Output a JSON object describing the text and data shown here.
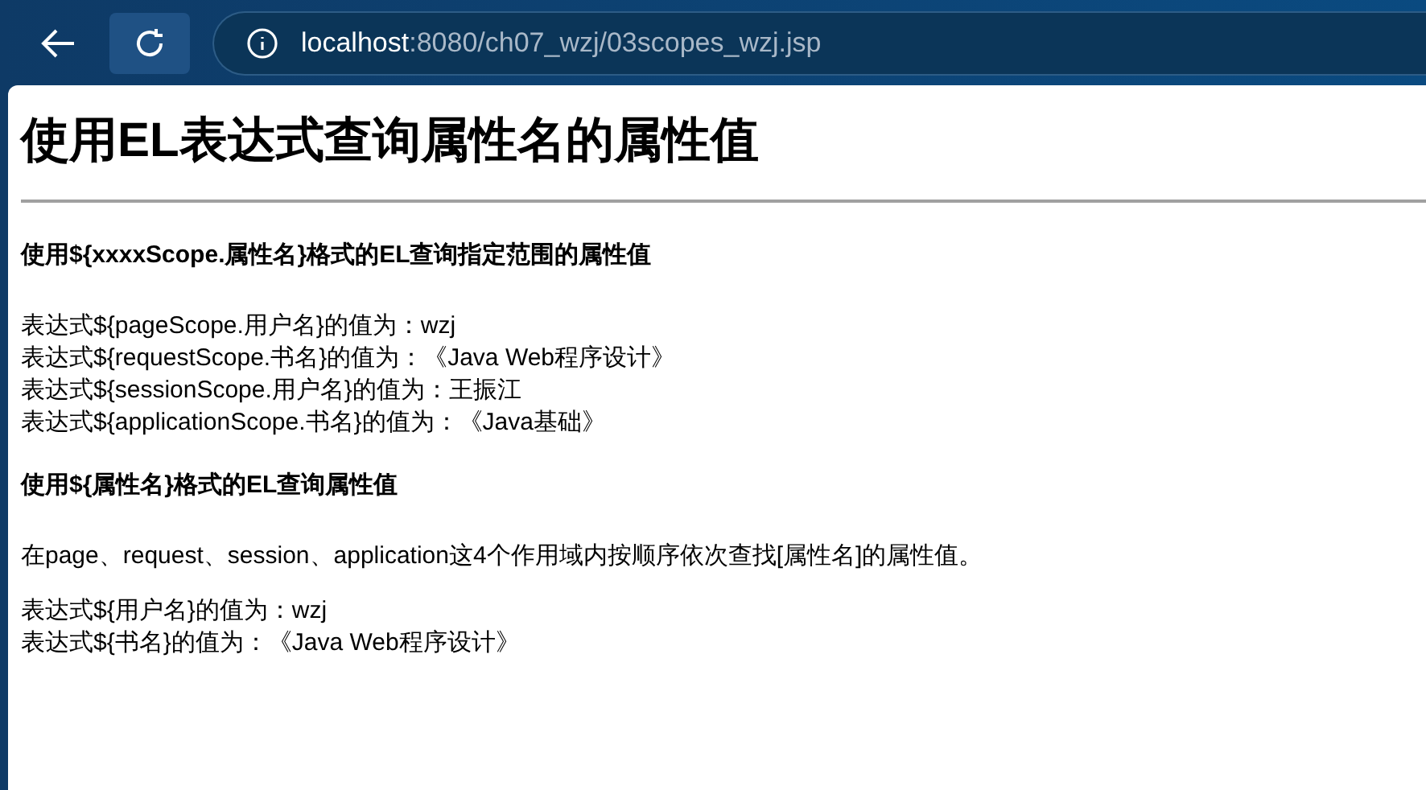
{
  "browser": {
    "url_host": "localhost",
    "url_path": ":8080/ch07_wzj/03scopes_wzj.jsp"
  },
  "page": {
    "title": "使用EL表达式查询属性名的属性值",
    "sections": [
      {
        "heading": "使用${xxxxScope.属性名}格式的EL查询指定范围的属性值",
        "lines": [
          "表达式${pageScope.用户名}的值为：wzj",
          "表达式${requestScope.书名}的值为：《Java Web程序设计》",
          "表达式${sessionScope.用户名}的值为：王振江",
          "表达式${applicationScope.书名}的值为：《Java基础》"
        ]
      },
      {
        "heading": "使用${属性名}格式的EL查询属性值",
        "paragraphs": [
          "在page、request、session、application这4个作用域内按顺序依次查找[属性名]的属性值。"
        ],
        "lines": [
          "表达式${用户名}的值为：wzj",
          "表达式${书名}的值为：《Java Web程序设计》"
        ]
      }
    ]
  }
}
